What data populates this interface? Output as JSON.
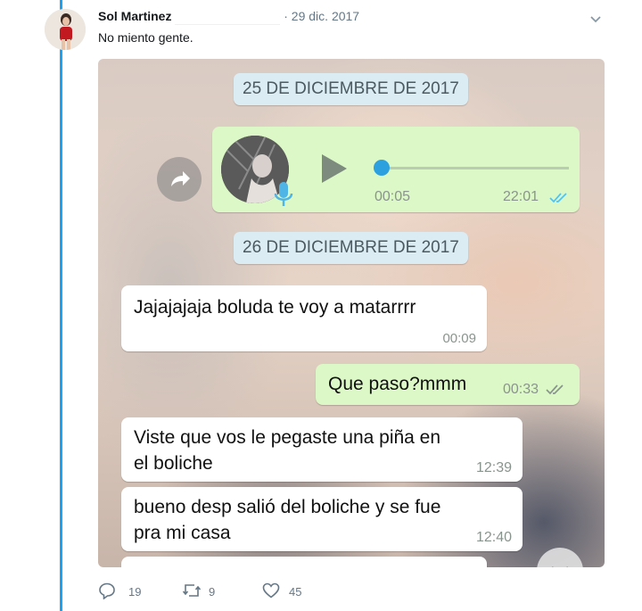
{
  "tweet": {
    "author_name": "Sol Martinez",
    "date": "· 29 dic. 2017",
    "text": "No miento gente.",
    "replies": "19",
    "retweets": "9",
    "likes": "45"
  },
  "chat": {
    "date_1": "25 DE DICIEMBRE DE 2017",
    "voice_note": {
      "duration": "00:05",
      "time": "22:01",
      "progress": 0
    },
    "date_2": "26 DE DICIEMBRE DE 2017",
    "messages": [
      {
        "dir": "in",
        "text": "Jajajajaja boluda te voy a matarrrr",
        "time": "00:09"
      },
      {
        "dir": "out",
        "text": "Que paso?mmm",
        "time": "00:33"
      },
      {
        "dir": "in",
        "text_line1": "Viste que vos le pegaste una piña en",
        "text_line2": "el boliche",
        "time": "12:39"
      },
      {
        "dir": "in",
        "text_line1": "bueno desp salió del boliche y se fue",
        "text_line2": "pra mi casa",
        "time": "12:40"
      }
    ]
  },
  "colors": {
    "accent": "#1da1f2",
    "bubble_out": "#dcf8c6",
    "ticks": "#4fc3f7"
  },
  "icons": [
    "chevron-down-icon",
    "forward-icon",
    "play-icon",
    "mic-icon",
    "double-check-icon",
    "reply-icon",
    "retweet-icon",
    "like-icon"
  ]
}
